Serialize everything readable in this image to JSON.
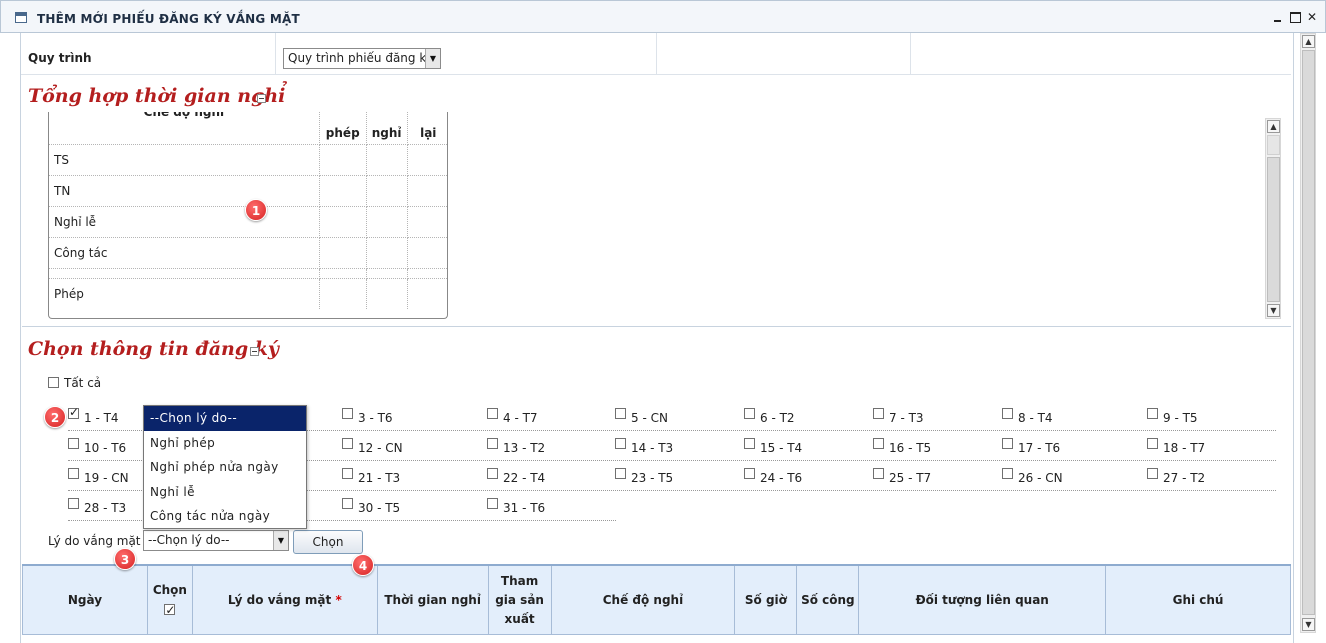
{
  "window": {
    "title": "THÊM MỚI PHIẾU ĐĂNG KÝ VẮNG MẶT",
    "minimize_label": "",
    "maximize_label": "",
    "close_label": "✕"
  },
  "process": {
    "label": "Quy trình",
    "selected_value": "Quy trình phiếu đăng k"
  },
  "summary_section": {
    "title": "Tổng hợp thời gian nghỉ",
    "columns": [
      "Chế độ nghỉ",
      "phép",
      "nghỉ",
      "lại"
    ],
    "rows": [
      "TS",
      "TN",
      "Nghỉ lễ",
      "Công tác",
      "",
      "Phép"
    ]
  },
  "register_section": {
    "title": "Chọn thông tin đăng ký",
    "select_all_label": "Tất cả",
    "days": [
      {
        "label": "1 - T4",
        "checked": true
      },
      {
        "label": "3 - T6",
        "checked": false
      },
      {
        "label": "4 - T7",
        "checked": false
      },
      {
        "label": "5 - CN",
        "checked": false
      },
      {
        "label": "6 - T2",
        "checked": false
      },
      {
        "label": "7 - T3",
        "checked": false
      },
      {
        "label": "8 - T4",
        "checked": false
      },
      {
        "label": "9 - T5",
        "checked": false
      },
      {
        "label": "10 - T6",
        "checked": false
      },
      {
        "label": "12 - CN",
        "checked": false
      },
      {
        "label": "13 - T2",
        "checked": false
      },
      {
        "label": "14 - T3",
        "checked": false
      },
      {
        "label": "15 - T4",
        "checked": false
      },
      {
        "label": "16 - T5",
        "checked": false
      },
      {
        "label": "17 - T6",
        "checked": false
      },
      {
        "label": "18 - T7",
        "checked": false
      },
      {
        "label": "19 - CN",
        "checked": false
      },
      {
        "label": "21 - T3",
        "checked": false
      },
      {
        "label": "22 - T4",
        "checked": false
      },
      {
        "label": "23 - T5",
        "checked": false
      },
      {
        "label": "24 - T6",
        "checked": false
      },
      {
        "label": "25 - T7",
        "checked": false
      },
      {
        "label": "26 - CN",
        "checked": false
      },
      {
        "label": "27 - T2",
        "checked": false
      },
      {
        "label": "28 - T3",
        "checked": false
      },
      {
        "label": "30 - T5",
        "checked": false
      },
      {
        "label": "31 - T6",
        "checked": false
      }
    ],
    "reason_dropdown_options": [
      "--Chọn lý do--",
      "Nghỉ phép",
      "Nghỉ phép nửa ngày",
      "Nghỉ lễ",
      "Công tác nửa ngày"
    ],
    "reason_label": "Lý do vắng mặt",
    "reason_selected": "--Chọn lý do--",
    "choose_button": "Chọn"
  },
  "detail_table": {
    "headers": {
      "date": "Ngày",
      "choose": "Chọn",
      "reason": "Lý do vắng mặt",
      "required_mark": "*",
      "off_time": "Thời gian nghỉ",
      "production_l1": "Tham",
      "production_l2": "gia sản",
      "production_l3": "xuất",
      "leave_mode": "Chế độ nghỉ",
      "hours": "Số giờ",
      "workdays": "Số công",
      "related": "Đối tượng liên quan",
      "note": "Ghi chú"
    },
    "choose_all_checked": true
  },
  "annotations": [
    "1",
    "2",
    "3",
    "4"
  ],
  "colors": {
    "section_title": "#b41e1e",
    "header_bg": "#e3eefb",
    "dropdown_selected_bg": "#0a246a",
    "badge": "#d62222"
  }
}
